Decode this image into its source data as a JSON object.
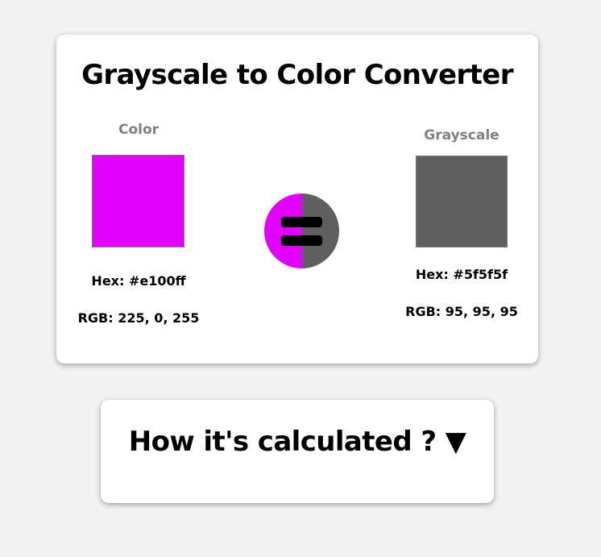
{
  "title": "Grayscale to Color Converter",
  "color": {
    "label": "Color",
    "hex_text": "Hex: #e100ff",
    "rgb_text": "RGB: 225, 0, 255",
    "swatch_color": "#e100ff"
  },
  "grayscale": {
    "label": "Grayscale",
    "hex_text": "Hex: #5f5f5f",
    "rgb_text": "RGB: 95, 95, 95",
    "swatch_color": "#5f5f5f"
  },
  "equals_icon": "equals-icon",
  "calculation": {
    "heading": "How it's calculated ? ▼"
  },
  "colors": {
    "background": "#f2f2f2",
    "card": "#ffffff",
    "label_gray": "#808080"
  }
}
